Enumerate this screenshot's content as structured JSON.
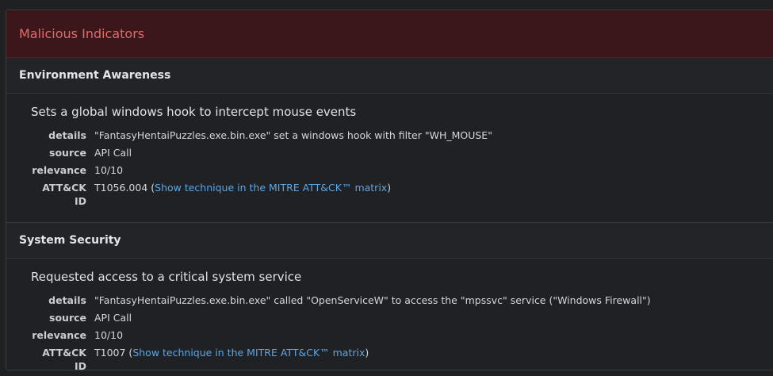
{
  "panel": {
    "title": "Malicious Indicators"
  },
  "sections": [
    {
      "title": "Environment Awareness",
      "indicator": "Sets a global windows hook to intercept mouse events",
      "labels": {
        "details": "details",
        "source": "source",
        "relevance": "relevance",
        "attck": "ATT&CK ID"
      },
      "details": "\"FantasyHentaiPuzzles.exe.bin.exe\" set a windows hook with filter \"WH_MOUSE\"",
      "source": "API Call",
      "relevance": "10/10",
      "attck_id": "T1056.004",
      "attck_link": "Show technique in the MITRE ATT&CK™ matrix"
    },
    {
      "title": "System Security",
      "indicator": "Requested access to a critical system service",
      "labels": {
        "details": "details",
        "source": "source",
        "relevance": "relevance",
        "attck": "ATT&CK ID"
      },
      "details": "\"FantasyHentaiPuzzles.exe.bin.exe\" called \"OpenServiceW\" to access the \"mpssvc\" service (\"Windows Firewall\")",
      "source": "API Call",
      "relevance": "10/10",
      "attck_id": "T1007",
      "attck_link": "Show technique in the MITRE ATT&CK™ matrix"
    }
  ]
}
